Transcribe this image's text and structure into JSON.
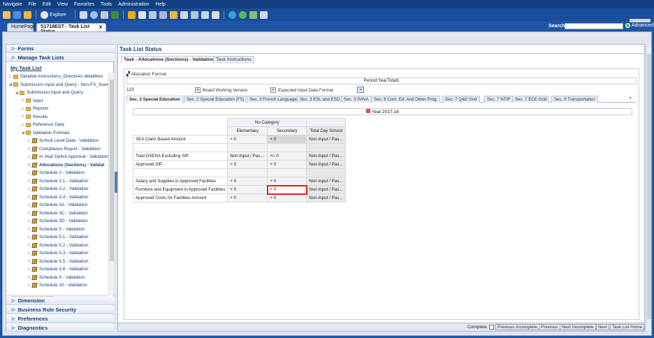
{
  "menu": [
    "Navigate",
    "File",
    "Edit",
    "View",
    "Favorites",
    "Tools",
    "Administration",
    "Help"
  ],
  "toolbar": {
    "explore_label": "Explore"
  },
  "tabs": {
    "home": "HomePage",
    "current": "S1718EST - Task List Status",
    "close": "✕"
  },
  "search": {
    "label": "Search:",
    "value": "",
    "advanced": "Advanced"
  },
  "left": {
    "forms": "Forms",
    "manage": "Manage Task Lists",
    "my_task_list": "My Task List",
    "tree": [
      {
        "label": "Detailed Instructions_Directives détaillées",
        "level": 0,
        "type": "folder",
        "arrow": "▷"
      },
      {
        "label": "Submission Input and Query - Non-FS_Soumi",
        "level": 0,
        "type": "folder",
        "arrow": "◢"
      },
      {
        "label": "Submission Input and Query",
        "level": 1,
        "type": "folder",
        "arrow": "◢"
      },
      {
        "label": "Input",
        "level": 2,
        "type": "folder",
        "arrow": "▷"
      },
      {
        "label": "Reports",
        "level": 2,
        "type": "folder",
        "arrow": "▷"
      },
      {
        "label": "Results",
        "level": 2,
        "type": "folder",
        "arrow": "▷"
      },
      {
        "label": "Reference Data",
        "level": 2,
        "type": "folder",
        "arrow": "▷"
      },
      {
        "label": "Validation Formats",
        "level": 2,
        "type": "folder",
        "arrow": "◢"
      },
      {
        "label": "School Level Data - Validation",
        "level": 3,
        "type": "form",
        "arrow": "▷"
      },
      {
        "label": "Compliance Report - Validation",
        "level": 3,
        "type": "form",
        "arrow": "▷"
      },
      {
        "label": "In-Year Deficit Approval - Validation",
        "level": 3,
        "type": "form",
        "arrow": "▷"
      },
      {
        "label": "Allocations (Sections) - Validat",
        "level": 3,
        "type": "form",
        "arrow": "▷",
        "selected": true
      },
      {
        "label": "Schedule 3 - Validation",
        "level": 3,
        "type": "form",
        "arrow": "▷"
      },
      {
        "label": "Schedule 3.1 - Validation",
        "level": 3,
        "type": "form",
        "arrow": "▷"
      },
      {
        "label": "Schedule 3.2 - Validation",
        "level": 3,
        "type": "form",
        "arrow": "▷"
      },
      {
        "label": "Schedule 3.4 - Validation",
        "level": 3,
        "type": "form",
        "arrow": "▷"
      },
      {
        "label": "Schedule 3A - Validation",
        "level": 3,
        "type": "form",
        "arrow": "▷"
      },
      {
        "label": "Schedule 3C - Validation",
        "level": 3,
        "type": "form",
        "arrow": "▷"
      },
      {
        "label": "Schedule 3D - Validation",
        "level": 3,
        "type": "form",
        "arrow": "▷"
      },
      {
        "label": "Schedule 5 - Validation",
        "level": 3,
        "type": "form",
        "arrow": "▷"
      },
      {
        "label": "Schedule 5.1 - Validation",
        "level": 3,
        "type": "form",
        "arrow": "▷"
      },
      {
        "label": "Schedule 5.2 - Validation",
        "level": 3,
        "type": "form",
        "arrow": "▷"
      },
      {
        "label": "Schedule 5.3 - Validation",
        "level": 3,
        "type": "form",
        "arrow": "▷"
      },
      {
        "label": "Schedule 5.5 - Validation",
        "level": 3,
        "type": "form",
        "arrow": "▷"
      },
      {
        "label": "Schedule 5.6 - Validation",
        "level": 3,
        "type": "form",
        "arrow": "▷"
      },
      {
        "label": "Schedule 9 - Validation",
        "level": 3,
        "type": "form",
        "arrow": "▷"
      },
      {
        "label": "Schedule 10 - Validation",
        "level": 3,
        "type": "form",
        "arrow": "▷"
      }
    ],
    "dimension": "Dimension",
    "business_rule": "Business Rule Security",
    "preferences": "Preferences",
    "diagnostics": "Diagnostics"
  },
  "right": {
    "title": "Task List Status",
    "task_tab": "Task - Allocations (Sections) - Validation",
    "instr_tab": "Task Instructions",
    "alloc_format": "Allocation Format",
    "period": "Period:YearTotal1",
    "pov_value": "123",
    "board_dd": "Board Working Version",
    "input_dd": "Expected Input Data Format",
    "go": "➔",
    "form_tabs": [
      "Sec. 2 Special Education",
      "Sec. 2 Special Education (FS)",
      "Sec. 3 French Language",
      "Sec. 3 ESL and ESD",
      "Sec. 3 PANA",
      "Sec. 6 Cont. Ed. And Other Prog.",
      "Sec. 7 Q&E Grid",
      "Sec. 7 NTIP",
      "Sec. 7 ECE Grid",
      "Sec. 9 Transportation"
    ],
    "more": "»",
    "year": "Year:2017-18",
    "grid": {
      "group_header": "No Category",
      "columns": [
        "Elementary",
        "Secondary",
        "Total Day School"
      ],
      "rows": [
        {
          "label": "SEA Claim Based Amount",
          "values": [
            "+ 0",
            "+ 0",
            "Non-Input / Pas..."
          ]
        },
        {
          "label": ".",
          "values": [
            "",
            "",
            ""
          ]
        },
        {
          "label": "Total DSENA Excluding SIP",
          "values": [
            "Non-Input / Pas...",
            "+/- 0",
            "Non-Input / Pas..."
          ]
        },
        {
          "label": "Approved SIP",
          "values": [
            "+ 0",
            "+ 0",
            "Non-Input / Pas..."
          ]
        },
        {
          "label": ".",
          "values": [
            "",
            "",
            ""
          ]
        },
        {
          "label": "Salary and Supplies in Approved Facilities",
          "values": [
            "+ 0",
            "+ 0",
            "Non-Input / Pas..."
          ]
        },
        {
          "label": "Furniture and Equipment in Approved Facilities",
          "values": [
            "+ 0",
            "+ 0",
            "Non-Input / Pas..."
          ]
        },
        {
          "label": "Approved Costs for Facilities Amount",
          "values": [
            "+ 0",
            "+ 0",
            "Non-Input / Pas..."
          ]
        }
      ]
    },
    "bottom": {
      "complete": "Complete",
      "prev_incomplete": "Previous Incomplete",
      "previous": "Previous",
      "next_incomplete": "Next Incomplete",
      "next": "Next",
      "home": "Task List Home"
    }
  }
}
